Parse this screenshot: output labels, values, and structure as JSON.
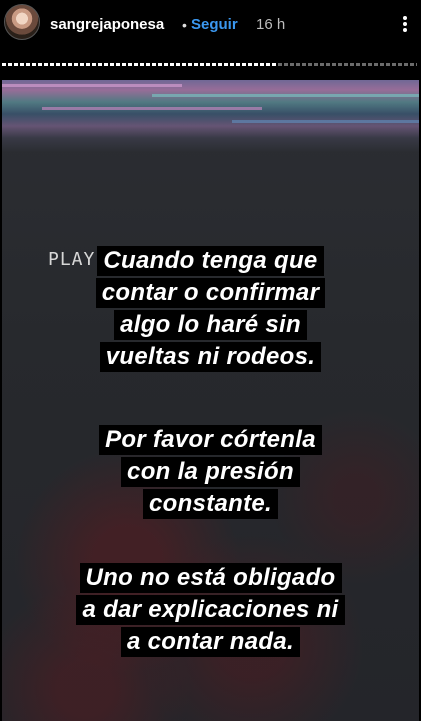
{
  "header": {
    "username": "sangrejaponesa",
    "separator": "•",
    "follow_label": "Seguir",
    "time": "16 h"
  },
  "story": {
    "progress": 0.66,
    "play_label": "PLAY▸",
    "paragraphs": [
      [
        "Cuando tenga que",
        "contar o confirmar",
        "algo lo haré sin",
        "vueltas ni rodeos."
      ],
      [
        "Por favor córtenla",
        "con la presión",
        "constante."
      ],
      [
        "Uno no está obligado",
        "a dar explicaciones ni",
        "a contar nada."
      ]
    ]
  },
  "icons": {
    "more": "more-options-icon",
    "avatar": "avatar"
  }
}
